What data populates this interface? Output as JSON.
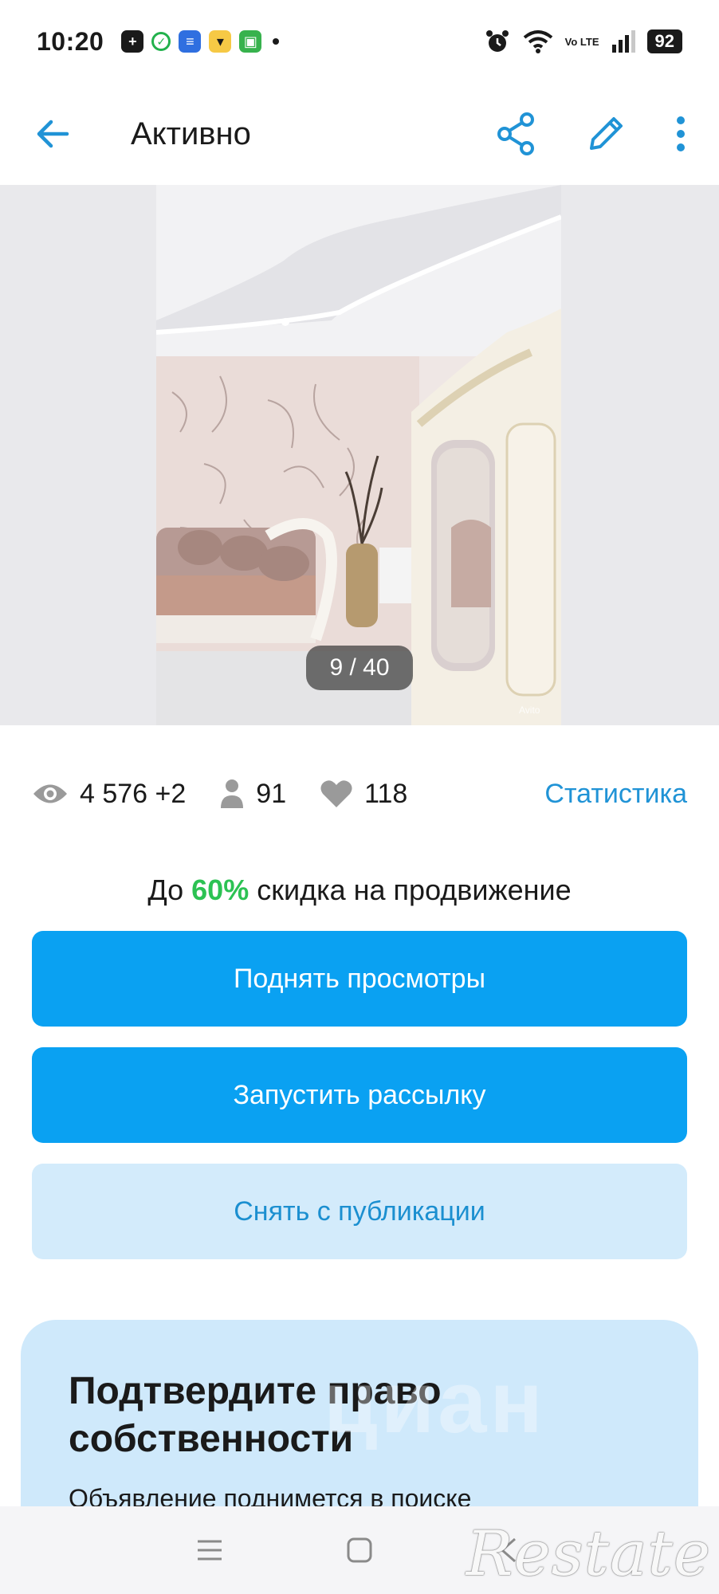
{
  "status_bar": {
    "time": "10:20",
    "battery": "92",
    "network": "Vo LTE"
  },
  "top_bar": {
    "title": "Активно",
    "accent_color": "#2093d6"
  },
  "photo": {
    "counter": "9 / 40",
    "watermark": "Avito"
  },
  "stats": {
    "views": "4 576 +2",
    "contacts": "91",
    "favorites": "118",
    "link_label": "Статистика"
  },
  "promo": {
    "prefix": "До ",
    "accent": "60%",
    "suffix": " скидка на продвижение",
    "accent_color": "#2cc253"
  },
  "buttons": {
    "raise_views": "Поднять просмотры",
    "start_mailing": "Запустить рассылку",
    "unpublish": "Снять с публикации"
  },
  "ownership_card": {
    "title": "Подтвердите право собственности",
    "subtitle": "Объявление поднимется в поиске",
    "watermark": "циан"
  },
  "overlay": {
    "brand": "Restate"
  }
}
